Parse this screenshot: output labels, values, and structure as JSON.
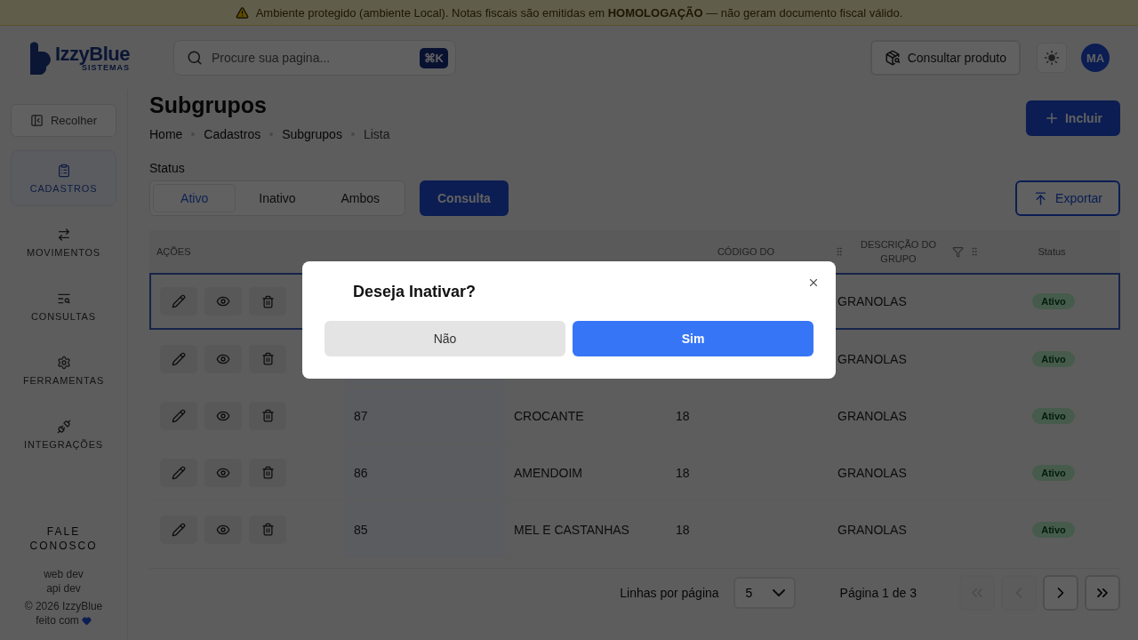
{
  "banner": {
    "text": "Ambiente protegido (ambiente Local). Notas fiscais são emitidas em **HOMOLOGAÇÃO** — não geram documento fiscal válido."
  },
  "header": {
    "logo": "IzzyBlue",
    "logo_subtitle": "SISTEMAS",
    "search": {
      "placeholder": "Procure sua pagina...",
      "shortcut": "⌘K"
    },
    "product_button": "Consultar produto",
    "avatar": "MA"
  },
  "sidebar": {
    "collapse": "Recolher",
    "items": [
      {
        "label": "CADASTROS",
        "selected": true
      },
      {
        "label": "MOVIMENTOS",
        "selected": false
      },
      {
        "label": "CONSULTAS",
        "selected": false
      },
      {
        "label": "FERRAMENTAS",
        "selected": false
      },
      {
        "label": "INTEGRAÇÕES",
        "selected": false
      }
    ],
    "contact": "FALE CONOSCO",
    "footer": [
      "web dev",
      "api dev",
      "© 2026 IzzyBlue",
      "feito com"
    ]
  },
  "page": {
    "title": "Subgrupos",
    "breadcrumbs": [
      "Home",
      "Cadastros",
      "Subgrupos",
      "Lista"
    ],
    "add_button": "Incluir",
    "status_label": "Status",
    "status_filter": [
      {
        "label": "Ativo",
        "selected": true
      },
      {
        "label": "Inativo",
        "selected": false
      },
      {
        "label": "Ambos",
        "selected": false
      }
    ],
    "query_button": "Consulta",
    "export_button": "Exportar"
  },
  "table": {
    "columns": [
      {
        "kind": "actions",
        "label": "AÇÕES"
      },
      {
        "kind": "code"
      },
      {
        "kind": "description"
      },
      {
        "kind": "group_code",
        "label": "CÓDIGO DO"
      },
      {
        "kind": "group_description",
        "label": "DESCRIÇÃO DO GRUPO"
      },
      {
        "kind": "status",
        "label": "Status"
      }
    ],
    "rows": [
      {
        "selected": true,
        "group_description": "GRANOLAS",
        "status": "Ativo"
      },
      {
        "selected": false,
        "group_description": "GRANOLAS",
        "status": "Ativo"
      },
      {
        "selected": false,
        "code": "87",
        "description": "CROCANTE",
        "group_code": "18",
        "group_description": "GRANOLAS",
        "status": "Ativo"
      },
      {
        "selected": false,
        "code": "86",
        "description": "AMENDOIM",
        "group_code": "18",
        "group_description": "GRANOLAS",
        "status": "Ativo"
      },
      {
        "selected": false,
        "code": "85",
        "description": "MEL E CASTANHAS",
        "group_code": "18",
        "group_description": "GRANOLAS",
        "status": "Ativo"
      }
    ]
  },
  "pagination": {
    "rows_label": "Linhas por página",
    "rows_value": "5",
    "page_label": "Página 1 de 3",
    "buttons": [
      {
        "kind": "first",
        "disabled": true
      },
      {
        "kind": "prev",
        "disabled": true
      },
      {
        "kind": "next",
        "disabled": false
      },
      {
        "kind": "last",
        "disabled": false
      }
    ]
  },
  "modal": {
    "title": "Deseja Inativar?",
    "buttons": [
      {
        "label": "Não",
        "kind": "secondary"
      },
      {
        "label": "Sim",
        "kind": "primary"
      }
    ]
  }
}
